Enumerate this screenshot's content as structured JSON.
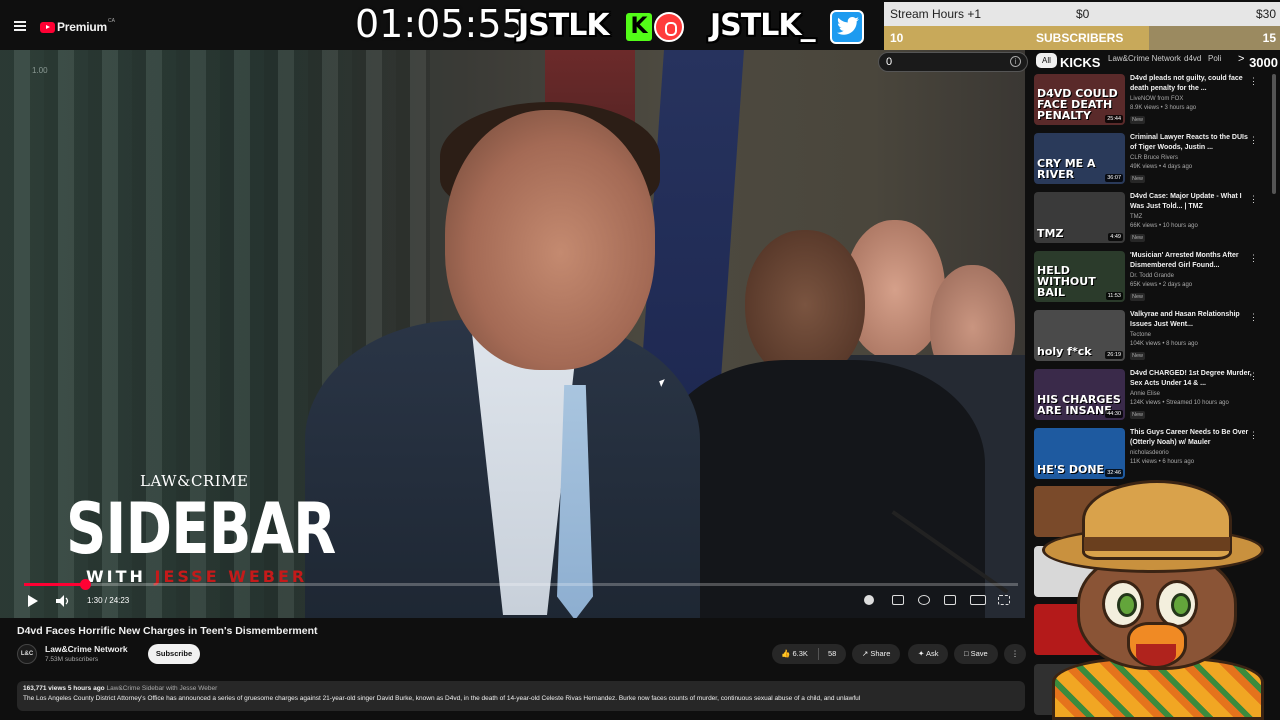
{
  "header": {
    "logo_text": "Premium",
    "logo_country": "CA"
  },
  "overlay": {
    "timer": "01:05:55",
    "brand_kick": "JSTLK",
    "kick_badge": "K",
    "brand_twitter": "JSTLK_",
    "goal_label": "Stream Hours +1",
    "goal_amount_start": "$0",
    "goal_amount_end": "$30",
    "subs_count": "10",
    "subs_label": "SUBSCRIBERS",
    "subs_target": "15",
    "subs_progress": 0.67,
    "kicks_value": "0",
    "kicks_label": "KICKS",
    "kicks_goal": "3000"
  },
  "chips": {
    "all": "All",
    "network": "Law&Crime Network",
    "d4vd": "d4vd",
    "poli": "Poli",
    "chevron": ">"
  },
  "video": {
    "watermark": "1.00",
    "logo_top": "LAW&CRIME",
    "logo_main": "SIDEBAR",
    "logo_with": "WITH",
    "logo_name": "JESSE WEBER",
    "current_time": "1:30",
    "duration": "24:23",
    "time_display": "1:30 / 24:23",
    "progress": 0.061
  },
  "watch": {
    "title": "D4vd Faces Horrific New Charges in Teen's Dismemberment",
    "channel_avatar_text": "L&C",
    "channel_name": "Law&Crime Network",
    "channel_subs": "7.53M subscribers",
    "subscribe_label": "Subscribe",
    "likes": "6.3K",
    "dislikes": "58",
    "share_label": "Share",
    "ask_label": "Ask",
    "save_label": "Save",
    "more_label": "⋮",
    "desc_meta": "163,771 views  5 hours ago",
    "desc_tag": "Law&Crime Sidebar with Jesse Weber",
    "desc_text": "The Los Angeles County District Attorney's Office has announced a series of gruesome charges against 21-year-old singer David Burke, known as D4vd, in the death of 14-year-old Celeste Rivas Hernandez. Burke now faces counts of murder, continuous sexual abuse of a child, and unlawful"
  },
  "recommendations": [
    {
      "thumb_text": "D4VD COULD FACE DEATH PENALTY",
      "duration": "25:44",
      "title": "D4vd pleads not guilty, could face death penalty for the ...",
      "channel": "LiveNOW from FOX",
      "meta": "8.9K views • 3 hours ago",
      "badge": "New",
      "color": "#5a2a2a"
    },
    {
      "thumb_text": "CRY ME A RIVER",
      "duration": "36:07",
      "title": "Criminal Lawyer Reacts to the DUIs of Tiger Woods, Justin ...",
      "channel": "CLR Bruce Rivers",
      "meta": "49K views • 4 days ago",
      "badge": "New",
      "color": "#2a3a5a"
    },
    {
      "thumb_text": "TMZ",
      "duration": "4:49",
      "title": "D4vd Case: Major Update - What I Was Just Told... | TMZ",
      "channel": "TMZ",
      "meta": "66K views • 10 hours ago",
      "badge": "New",
      "color": "#3a3a3a"
    },
    {
      "thumb_text": "HELD WITHOUT BAIL",
      "duration": "11:53",
      "title": "'Musician' Arrested Months After Dismembered Girl Found...",
      "channel": "Dr. Todd Grande",
      "meta": "65K views • 2 days ago",
      "badge": "New",
      "color": "#2b3b2b"
    },
    {
      "thumb_text": "holy f*ck",
      "duration": "26:19",
      "title": "Valkyrae and Hasan Relationship Issues Just Went...",
      "channel": "Tectone",
      "meta": "104K views • 8 hours ago",
      "badge": "New",
      "color": "#4a4a4a"
    },
    {
      "thumb_text": "HIS CHARGES ARE INSANE",
      "duration": "44:30",
      "title": "D4vd CHARGED! 1st Degree Murder, Sex Acts Under 14 & ...",
      "channel": "Annie Elise",
      "meta": "124K views • Streamed 10 hours ago",
      "badge": "New",
      "color": "#3a2a4a"
    },
    {
      "thumb_text": "HE'S DONE",
      "duration": "32:46",
      "title": "This Guys Career Needs to Be Over (Otterly Noah) w/ Mauler",
      "channel": "nicholasdeorio",
      "meta": "11K views • 6 hours ago",
      "badge": "",
      "color": "#1e5aa0"
    }
  ],
  "colors": {
    "accent_red": "#ff0033",
    "kick_green": "#53fc18",
    "twitter_blue": "#1d9bf0",
    "goal_gold": "#c8a95a"
  },
  "icons": [
    "menu-icon",
    "youtube-logo-icon",
    "record-icon",
    "twitter-bird-icon",
    "info-icon",
    "play-icon",
    "volume-icon",
    "autoplay-icon",
    "captions-icon",
    "settings-icon",
    "miniplayer-icon",
    "theater-icon",
    "fullscreen-icon",
    "like-icon",
    "dislike-icon",
    "share-icon",
    "ask-icon",
    "save-icon",
    "more-icon"
  ]
}
